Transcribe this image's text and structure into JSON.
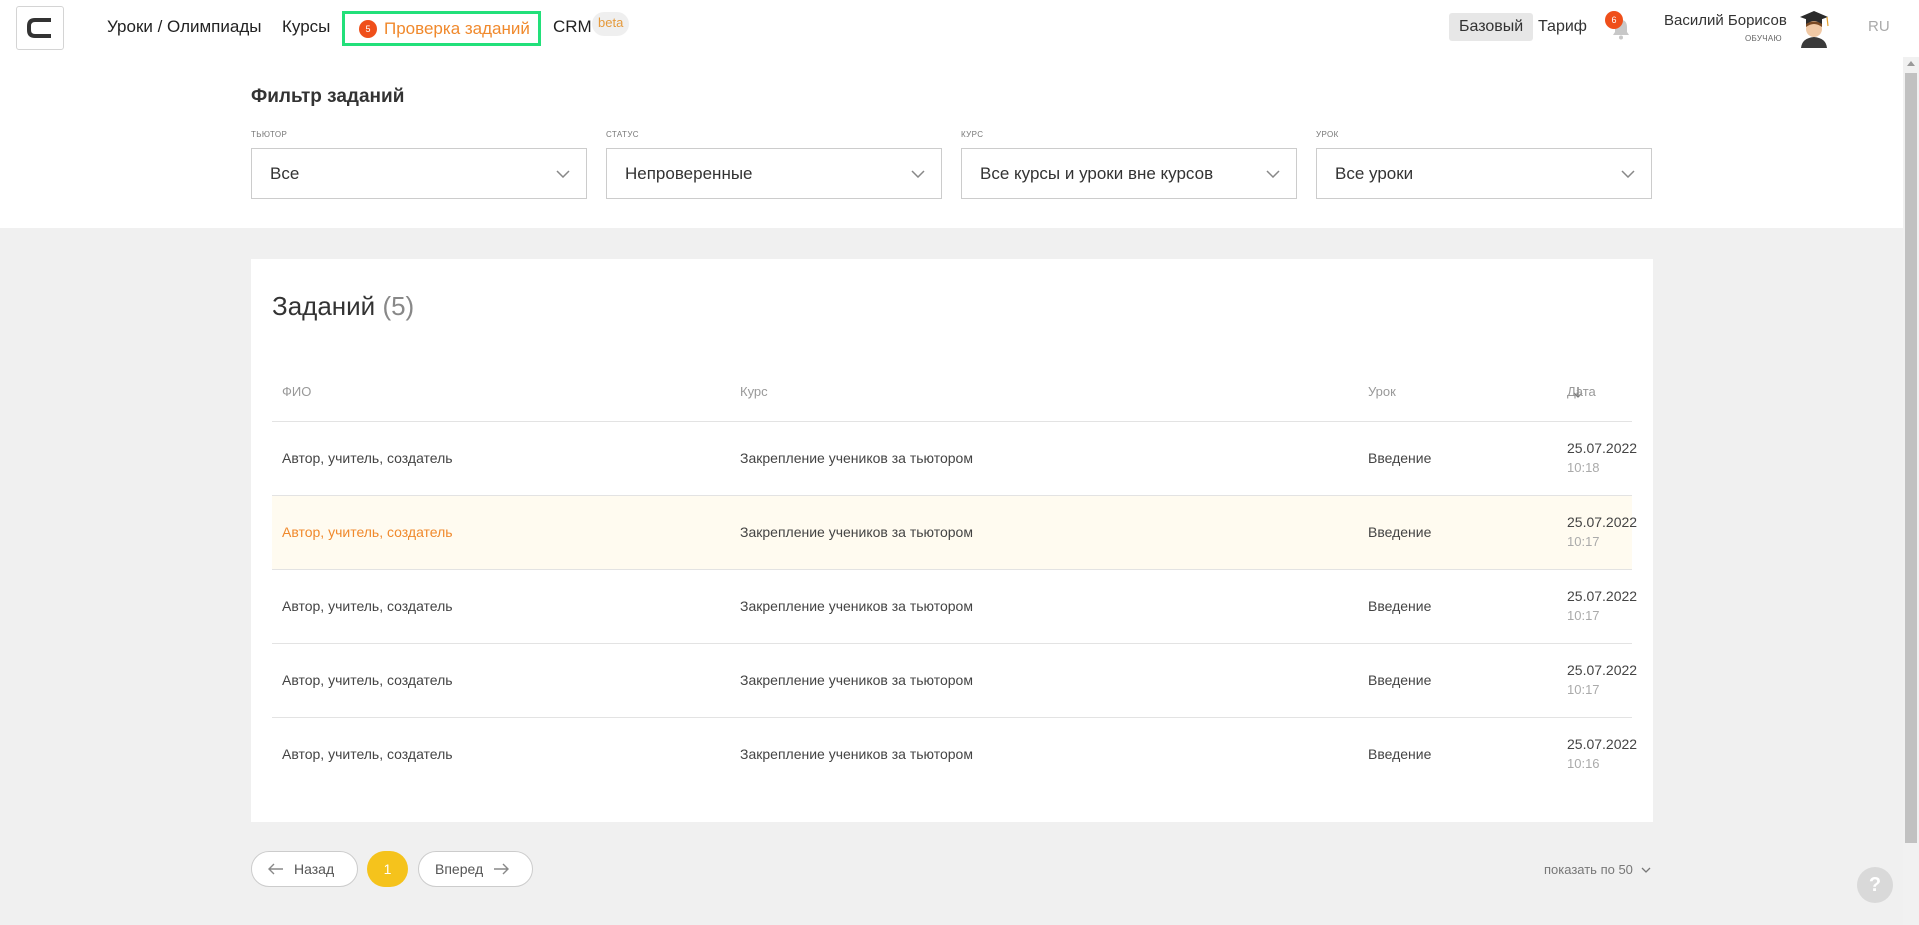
{
  "header": {
    "nav": {
      "lessons": "Уроки / Олимпиады",
      "courses": "Курсы",
      "check": "Проверка заданий",
      "check_badge": "5",
      "crm": "CRM",
      "beta": "beta"
    },
    "plan": "Базовый",
    "tariff": "Тариф",
    "notifications_badge": "6",
    "user": {
      "name": "Василий Борисов",
      "role": "ОБУЧАЮ"
    },
    "lang": "RU"
  },
  "filters": {
    "title": "Фильтр заданий",
    "items": [
      {
        "caption": "ТЬЮТОР",
        "value": "Все"
      },
      {
        "caption": "СТАТУС",
        "value": "Непроверенные"
      },
      {
        "caption": "КУРС",
        "value": "Все курсы и уроки вне курсов"
      },
      {
        "caption": "УРОК",
        "value": "Все уроки"
      }
    ]
  },
  "tasks": {
    "title": "Заданий",
    "count": "(5)",
    "columns": {
      "fio": "ФИО",
      "course": "Курс",
      "lesson": "Урок",
      "date": "Дата"
    },
    "rows": [
      {
        "fio": "Автор, учитель, создатель",
        "course": "Закрепление учеников за тьютором",
        "lesson": "Введение",
        "date": "25.07.2022",
        "time": "10:18"
      },
      {
        "fio": "Автор, учитель, создатель",
        "course": "Закрепление учеников за тьютором",
        "lesson": "Введение",
        "date": "25.07.2022",
        "time": "10:17"
      },
      {
        "fio": "Автор, учитель, создатель",
        "course": "Закрепление учеников за тьютором",
        "lesson": "Введение",
        "date": "25.07.2022",
        "time": "10:17"
      },
      {
        "fio": "Автор, учитель, создатель",
        "course": "Закрепление учеников за тьютором",
        "lesson": "Введение",
        "date": "25.07.2022",
        "time": "10:17"
      },
      {
        "fio": "Автор, учитель, создатель",
        "course": "Закрепление учеников за тьютором",
        "lesson": "Введение",
        "date": "25.07.2022",
        "time": "10:16"
      }
    ]
  },
  "pagination": {
    "prev": "Назад",
    "current": "1",
    "next": "Вперед",
    "per_page": "показать по 50"
  },
  "help": "?",
  "colors": {
    "accent": "#f0892c",
    "badge": "#ef4f1a",
    "page": "#f5c31c",
    "highlight_border": "#22e07a"
  }
}
